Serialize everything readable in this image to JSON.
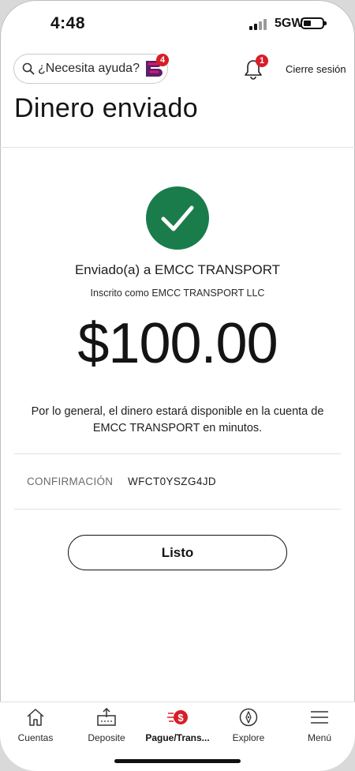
{
  "status_bar": {
    "time": "4:48",
    "network": "5GW",
    "icons": [
      "signal-icon",
      "battery-icon"
    ]
  },
  "header": {
    "search_placeholder": "¿Necesita ayuda?",
    "assistant_badge": "4",
    "notification_badge": "1",
    "logout_label": "Cierre sesión",
    "title": "Dinero enviado"
  },
  "confirmation": {
    "sent_to": "Enviado(a) a EMCC TRANSPORT",
    "enrolled_as": "Inscrito como EMCC TRANSPORT LLC",
    "amount": "$100.00",
    "availability_note": "Por lo general, el dinero estará disponible en la cuenta de EMCC TRANSPORT en minutos.",
    "confirmation_label": "CONFIRMACIÓN",
    "confirmation_code": "WFCT0YSZG4JD",
    "done_button": "Listo"
  },
  "bottom_nav": {
    "tabs": [
      {
        "label": "Cuentas",
        "icon": "home-icon",
        "active": false
      },
      {
        "label": "Deposite",
        "icon": "deposit-icon",
        "active": false
      },
      {
        "label": "Pague/Trans...",
        "icon": "pay-transfer-icon",
        "active": true
      },
      {
        "label": "Explore",
        "icon": "compass-icon",
        "active": false
      },
      {
        "label": "Menú",
        "icon": "menu-icon",
        "active": false
      }
    ]
  },
  "colors": {
    "success_green": "#1a7c4b",
    "badge_red": "#d71e28",
    "brand_purple": "#5a1f6a",
    "brand_pink": "#e0136c"
  }
}
